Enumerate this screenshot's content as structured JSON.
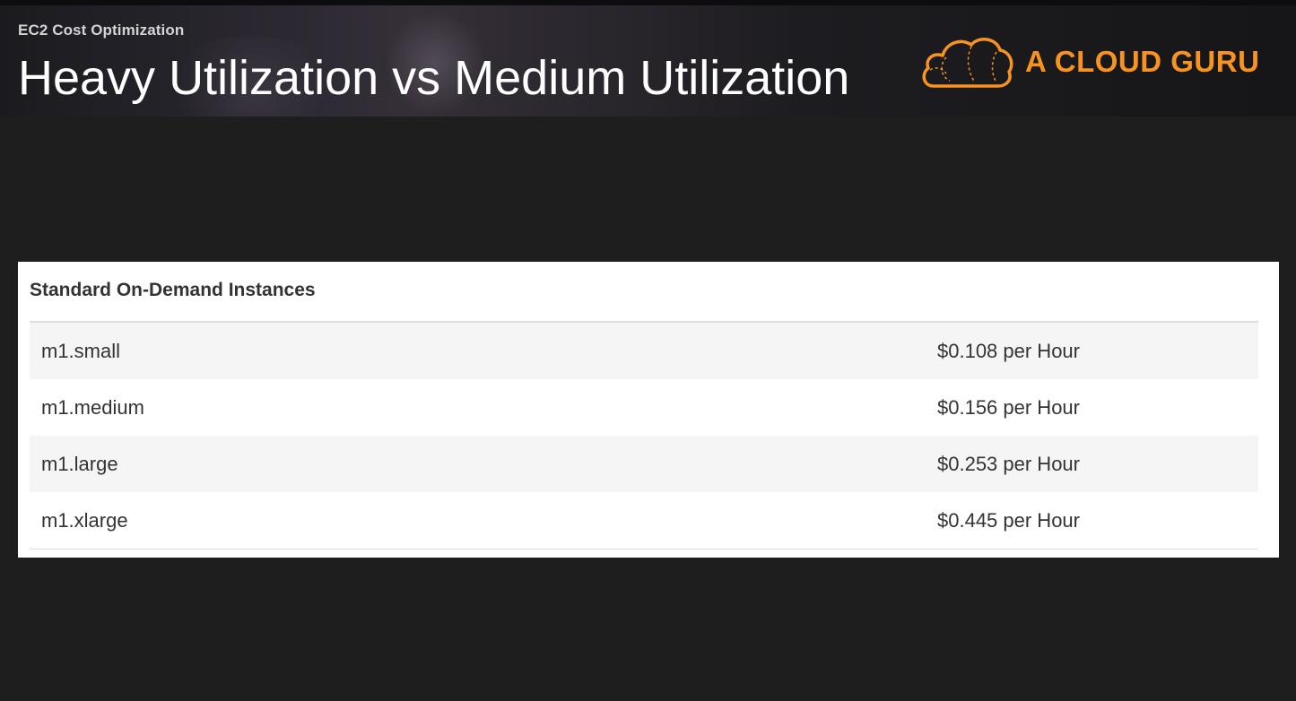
{
  "header": {
    "subtitle": "EC2 Cost Optimization",
    "title": "Heavy Utilization vs Medium Utilization"
  },
  "logo": {
    "text": "A CLOUD GURU",
    "icon": "cloud-icon",
    "color": "#f7931e"
  },
  "table": {
    "title": "Standard On-Demand Instances",
    "rows": [
      {
        "name": "m1.small",
        "price": "$0.108 per Hour"
      },
      {
        "name": "m1.medium",
        "price": "$0.156 per Hour"
      },
      {
        "name": "m1.large",
        "price": "$0.253 per Hour"
      },
      {
        "name": "m1.xlarge",
        "price": "$0.445 per Hour"
      }
    ]
  },
  "colors": {
    "background": "#1e1e1e",
    "card": "#ffffff",
    "row_alt": "#f5f5f5",
    "accent": "#f7931e"
  }
}
